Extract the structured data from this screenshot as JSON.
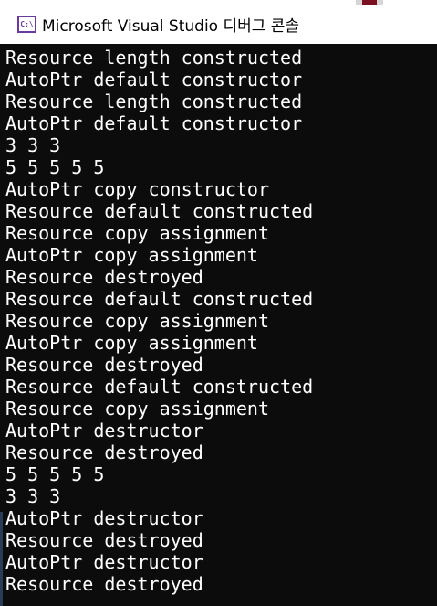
{
  "window": {
    "title": "Microsoft Visual Studio 디버그 콘솔",
    "icon": "console-app-icon",
    "icon_text": "C:\\"
  },
  "console": {
    "lines": [
      "Resource length constructed",
      "AutoPtr default constructor",
      "Resource length constructed",
      "AutoPtr default constructor",
      "3 3 3",
      "5 5 5 5 5",
      "AutoPtr copy constructor",
      "Resource default constructed",
      "Resource copy assignment",
      "AutoPtr copy assignment",
      "Resource destroyed",
      "Resource default constructed",
      "Resource copy assignment",
      "AutoPtr copy assignment",
      "Resource destroyed",
      "Resource default constructed",
      "Resource copy assignment",
      "AutoPtr destructor",
      "Resource destroyed",
      "5 5 5 5 5",
      "3 3 3",
      "AutoPtr destructor",
      "Resource destroyed",
      "AutoPtr destructor",
      "Resource destroyed"
    ]
  },
  "colors": {
    "console_bg": "#0c0c0c",
    "console_text": "#ffffff",
    "titlebar_bg": "#ffffff",
    "icon_accent": "#6b3aa0"
  }
}
